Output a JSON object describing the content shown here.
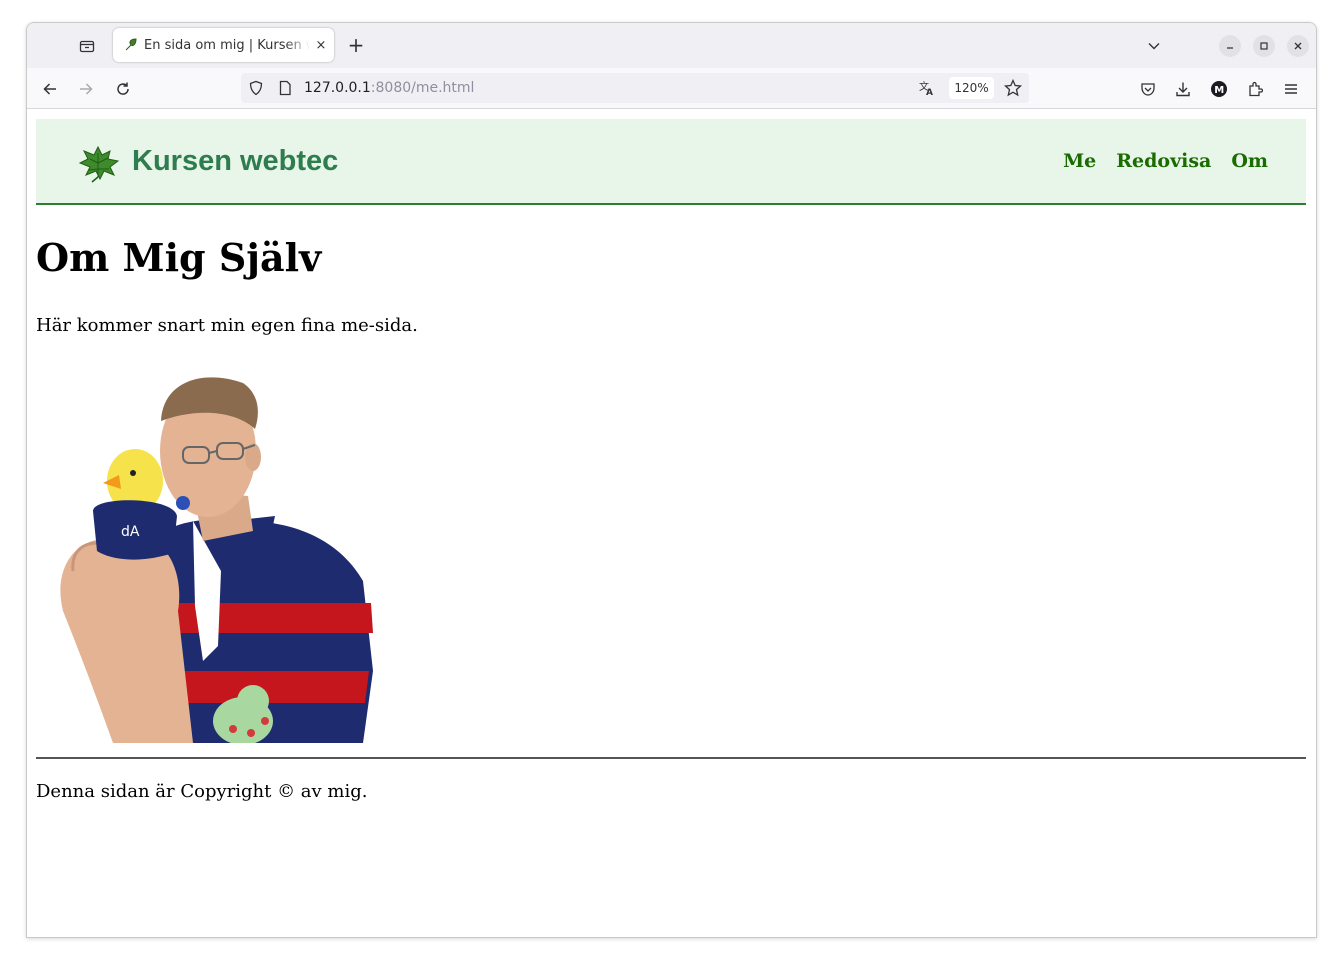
{
  "browser": {
    "tab_title": "En sida om mig | Kursen webtec",
    "tab_close": "×",
    "new_tab": "+",
    "url_host": "127.0.0.1",
    "url_path": ":8080/me.html",
    "zoom": "120%",
    "icons": [
      "tab-list-icon",
      "chevron-down-icon",
      "minimize-icon",
      "maximize-icon",
      "close-window-icon",
      "back-arrow-icon",
      "forward-arrow-icon",
      "reload-icon",
      "shield-icon",
      "page-icon",
      "translate-icon",
      "bookmark-star-icon",
      "pocket-icon",
      "download-icon",
      "account-icon",
      "extensions-icon",
      "menu-icon"
    ]
  },
  "site": {
    "title": "Kursen webtec",
    "nav": [
      "Me",
      "Redovisa",
      "Om"
    ],
    "accent": "#2e7d32",
    "header_bg": "#e8f5e9",
    "nav_color": "#1a6b00"
  },
  "main": {
    "heading": "Om Mig Själv",
    "intro": "Här kommer snart min egen fina me-sida."
  },
  "footer": {
    "text": "Denna sidan är Copyright © av mig."
  }
}
